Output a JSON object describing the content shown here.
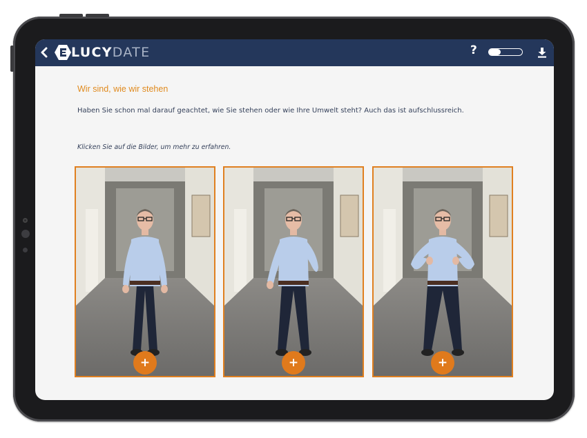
{
  "header": {
    "logo_lucy": "LUCY",
    "logo_date": "DATE",
    "help_label": "?",
    "toggle_value": 0.35
  },
  "content": {
    "heading": "Wir sind, wie wir stehen",
    "intro": "Haben Sie schon mal darauf geachtet, wie Sie stehen oder wie Ihre Umwelt steht? Auch das ist aufschlussreich.",
    "hint": "Klicken Sie auf die Bilder, um mehr zu erfahren.",
    "cards": [
      {
        "pose": "arms-down",
        "plus_label": "+"
      },
      {
        "pose": "hand-in-pocket",
        "plus_label": "+"
      },
      {
        "pose": "hands-on-hips",
        "plus_label": "+"
      }
    ]
  },
  "colors": {
    "header_bg": "#24375b",
    "accent_orange": "#e07f1f",
    "screen_bg": "#f5f5f5",
    "text_dark": "#34405a"
  },
  "icons": [
    "back-chevron-icon",
    "lucydate-logo-icon",
    "help-icon",
    "download-icon",
    "plus-icon"
  ]
}
